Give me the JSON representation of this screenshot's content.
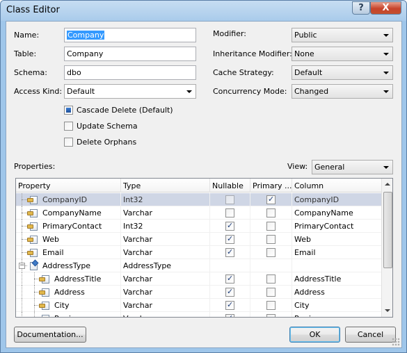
{
  "window": {
    "title": "Class Editor",
    "help_glyph": "?",
    "close_glyph": "X"
  },
  "form": {
    "name_label": "Name:",
    "name_value": "Company",
    "table_label": "Table:",
    "table_value": "Company",
    "schema_label": "Schema:",
    "schema_value": "dbo",
    "access_kind_label": "Access Kind:",
    "access_kind_value": "Default",
    "modifier_label": "Modifier:",
    "modifier_value": "Public",
    "inheritance_label": "Inheritance Modifier:",
    "inheritance_value": "None",
    "cache_label": "Cache Strategy:",
    "cache_value": "Default",
    "concurrency_label": "Concurrency Mode:",
    "concurrency_value": "Changed",
    "cascade_delete_label": "Cascade Delete (Default)",
    "update_schema_label": "Update Schema",
    "delete_orphans_label": "Delete Orphans"
  },
  "properties": {
    "label": "Properties:",
    "view_label": "View:",
    "view_value": "General",
    "columns": [
      "Property",
      "Type",
      "Nullable",
      "Primary ...",
      "Column"
    ],
    "rows": [
      {
        "property": "CompanyID",
        "type": "Int32",
        "nullable": false,
        "primary": true,
        "column": "CompanyID",
        "selected": true
      },
      {
        "property": "CompanyName",
        "type": "Varchar",
        "nullable": false,
        "primary": false,
        "column": "CompanyName"
      },
      {
        "property": "PrimaryContact",
        "type": "Int32",
        "nullable": true,
        "primary": false,
        "column": "PrimaryContact"
      },
      {
        "property": "Web",
        "type": "Varchar",
        "nullable": true,
        "primary": false,
        "column": "Web"
      },
      {
        "property": "Email",
        "type": "Varchar",
        "nullable": true,
        "primary": false,
        "column": "Email"
      },
      {
        "property": "AddressType",
        "type": "AddressType",
        "nullable": null,
        "primary": null,
        "column": ""
      },
      {
        "property": "AddressTitle",
        "type": "Varchar",
        "nullable": true,
        "primary": false,
        "column": "AddressTitle"
      },
      {
        "property": "Address",
        "type": "Varchar",
        "nullable": true,
        "primary": false,
        "column": "Address"
      },
      {
        "property": "City",
        "type": "Varchar",
        "nullable": true,
        "primary": false,
        "column": "City"
      },
      {
        "property": "Region",
        "type": "Varchar",
        "nullable": true,
        "primary": false,
        "column": "Region"
      }
    ]
  },
  "buttons": {
    "documentation": "Documentation...",
    "ok": "OK",
    "cancel": "Cancel"
  }
}
